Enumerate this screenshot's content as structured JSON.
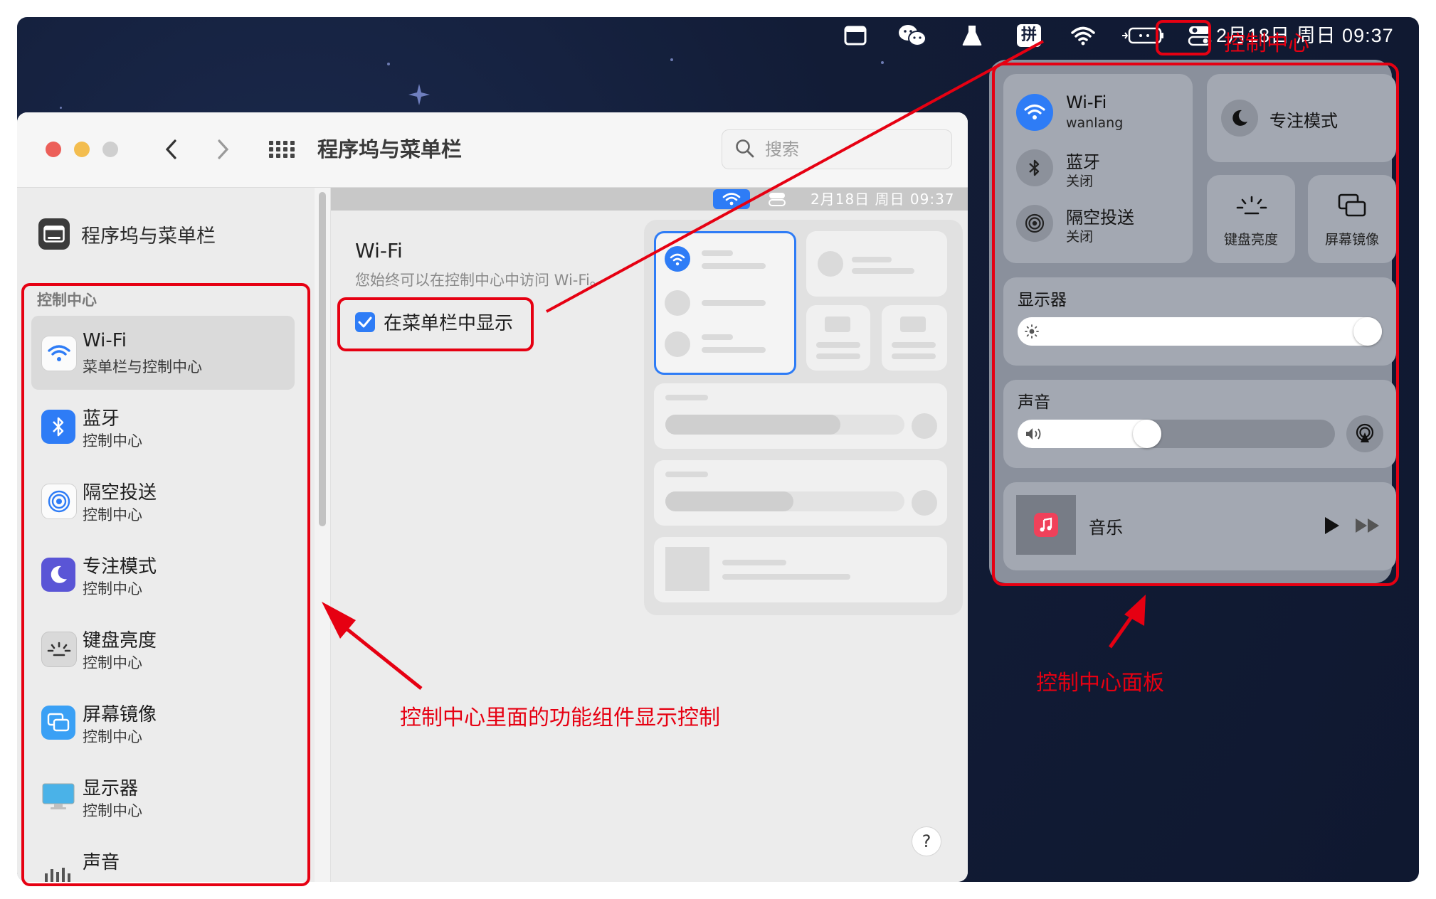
{
  "menubar": {
    "clock": "2月18日 周日 09:37",
    "icons": [
      "window-icon",
      "wechat-icon",
      "flask-icon",
      "input-method-icon",
      "wifi-icon",
      "battery-icon",
      "control-center-icon"
    ],
    "input_method_glyph": "拼"
  },
  "window": {
    "title": "程序坞与菜单栏",
    "search_placeholder": "搜索"
  },
  "sidebar": {
    "top_item": "程序坞与菜单栏",
    "section": "控制中心",
    "items": [
      {
        "label": "Wi-Fi",
        "sub": "菜单栏与控制中心",
        "icon": "wifi-icon",
        "active": true
      },
      {
        "label": "蓝牙",
        "sub": "控制中心",
        "icon": "bluetooth-icon"
      },
      {
        "label": "隔空投送",
        "sub": "控制中心",
        "icon": "airdrop-icon"
      },
      {
        "label": "专注模式",
        "sub": "控制中心",
        "icon": "moon-icon"
      },
      {
        "label": "键盘亮度",
        "sub": "控制中心",
        "icon": "keyboard-brightness-icon"
      },
      {
        "label": "屏幕镜像",
        "sub": "控制中心",
        "icon": "screen-mirroring-icon"
      },
      {
        "label": "显示器",
        "sub": "控制中心",
        "icon": "display-icon"
      },
      {
        "label": "声音",
        "sub": "",
        "icon": "sound-icon"
      }
    ]
  },
  "content": {
    "preview_clock": "2月18日 周日 09:37",
    "heading": "Wi-Fi",
    "description": "您始终可以在控制中心中访问 Wi-Fi。",
    "checkbox_label": "在菜单栏中显示",
    "checkbox_checked": true,
    "help": "?"
  },
  "control_center": {
    "wifi": {
      "title": "Wi-Fi",
      "sub": "wanlang"
    },
    "bluetooth": {
      "title": "蓝牙",
      "sub": "关闭"
    },
    "airdrop": {
      "title": "隔空投送",
      "sub": "关闭"
    },
    "focus": "专注模式",
    "keyboard_brightness": "键盘亮度",
    "screen_mirroring": "屏幕镜像",
    "display": {
      "title": "显示器",
      "level": 1.0
    },
    "sound": {
      "title": "声音",
      "level": 0.4
    },
    "music": "音乐"
  },
  "annotations": {
    "cc_label": "控制中心",
    "sidebar_note": "控制中心里面的功能组件显示控制",
    "panel_note": "控制中心面板",
    "color": "#e60012"
  }
}
